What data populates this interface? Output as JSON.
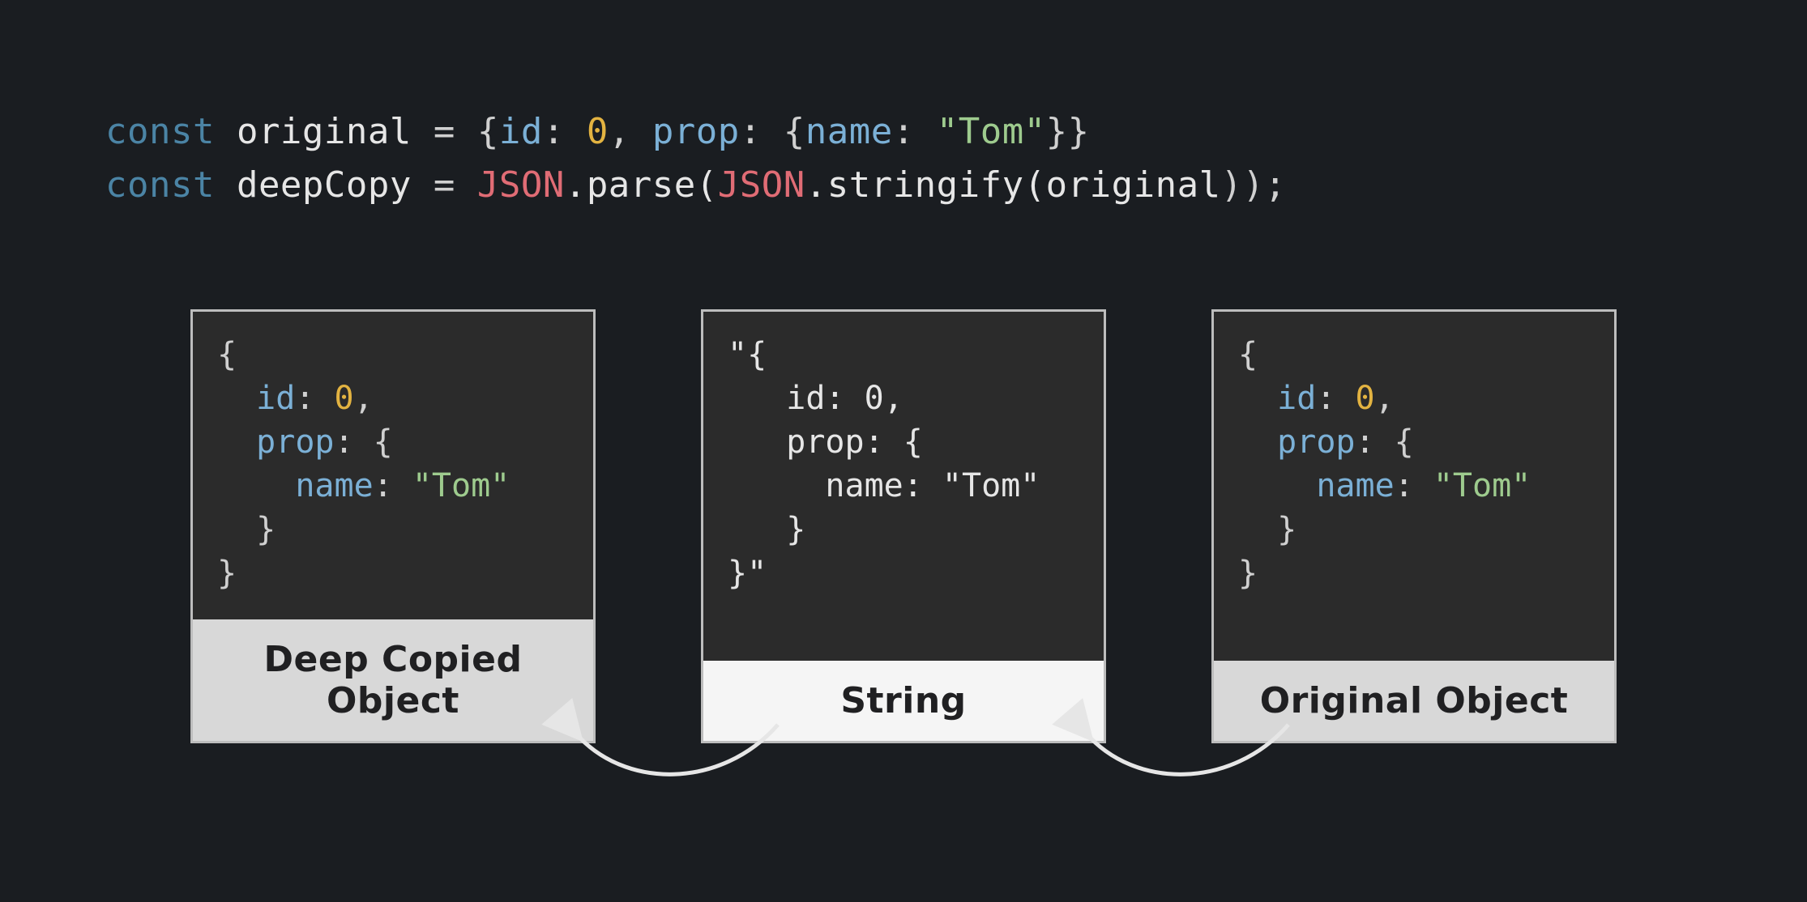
{
  "syntax_colors": {
    "keyword": "#4b84a5",
    "identifier": "#e6e6e6",
    "punctuation": "#d0d0d0",
    "property": "#7bb0d6",
    "number": "#e3b341",
    "class_name": "#e06c75",
    "string": "#9ecb8e",
    "background": "#1a1d21",
    "panel_border": "#bdbdbd",
    "caption_bg": "#d8d8d8",
    "caption_bg_highlight": "#f5f5f5"
  },
  "code": {
    "line1": {
      "const": "const ",
      "var": "original",
      "eq": " = ",
      "obrace": "{",
      "id_key": "id",
      "id_colon": ": ",
      "id_val": "0",
      "comma1": ", ",
      "prop_key": "prop",
      "prop_colon": ": ",
      "obrace2": "{",
      "name_key": "name",
      "name_colon": ": ",
      "name_val": "\"Tom\"",
      "cbrace2": "}",
      "cbrace": "}"
    },
    "line2": {
      "const": "const ",
      "var": "deepCopy",
      "eq": " = ",
      "json1": "JSON",
      "parse": ".parse(",
      "json2": "JSON",
      "stringify": ".stringify(",
      "arg": "original",
      "close": "));"
    }
  },
  "panels": {
    "deep": {
      "caption": "Deep Copied Object",
      "body": {
        "open": "{",
        "id_key": "id",
        "id_colon": ": ",
        "id_val": "0",
        "comma1": ",",
        "prop_key": "prop",
        "prop_colon": ": ",
        "obrace": "{",
        "name_key": "name",
        "name_colon": ": ",
        "name_val": "\"Tom\"",
        "cbrace": "}",
        "close": "}"
      }
    },
    "string": {
      "caption": "String",
      "body": {
        "open": "\"{",
        "id_line": "   id: 0,",
        "prop_line": "   prop: {",
        "name_line": "     name: \"Tom\"",
        "close_inner": "   }",
        "close": "}\""
      }
    },
    "original": {
      "caption": "Original Object",
      "body": {
        "open": "{",
        "id_key": "id",
        "id_colon": ": ",
        "id_val": "0",
        "comma1": ",",
        "prop_key": "prop",
        "prop_colon": ": ",
        "obrace": "{",
        "name_key": "name",
        "name_colon": ": ",
        "name_val": "\"Tom\"",
        "cbrace": "}",
        "close": "}"
      }
    }
  }
}
